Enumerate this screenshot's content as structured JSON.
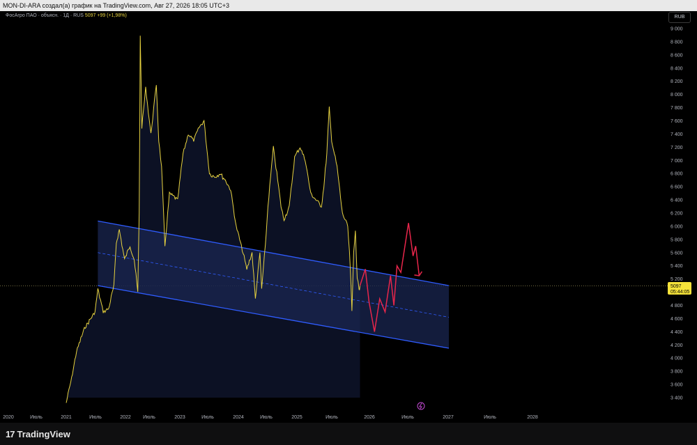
{
  "header": {
    "text": "MON-DI-ARA создал(а) график на TradingView.com, Авг 27, 2026 18:05 UTC+3"
  },
  "legend": {
    "symbol": "ФосАгро ПАО · объясн. · 1Д · RUS",
    "value": "5097 +99 (+1,98%)"
  },
  "currency": "RUB",
  "price_label": {
    "price": "5097",
    "countdown": "05:44:05"
  },
  "brand": {
    "logo": "17",
    "name": "TradingView"
  },
  "colors": {
    "price_line": "#e8d33f",
    "area_fill": "#1a2650",
    "channel": "#2f5cff",
    "forecast": "#e8264b",
    "label_bg": "#f5e23a"
  },
  "icons": [
    "lightning-icon",
    "tradingview-logo"
  ],
  "chart_data": {
    "type": "line",
    "x_ticks": [
      "2020",
      "Июль",
      "2021",
      "Июль",
      "2022",
      "Июль",
      "2023",
      "Июль",
      "2024",
      "Июль",
      "2025",
      "Июль",
      "2026",
      "Июль",
      "2027",
      "Июль",
      "2028"
    ],
    "y_ticks": [
      "9 000",
      "8 800",
      "8 600",
      "8 400",
      "8 200",
      "8 000",
      "7 800",
      "7 600",
      "7 400",
      "7 200",
      "7 000",
      "6 800",
      "6 600",
      "6 400",
      "6 200",
      "6 000",
      "5 800",
      "5 600",
      "5 400",
      "5 200",
      "4 800",
      "4 600",
      "4 400",
      "4 200",
      "4 000",
      "3 800",
      "3 600",
      "3 400"
    ],
    "y_range": [
      3300,
      9100
    ],
    "last_price": 5097,
    "series": [
      {
        "values": [
          [
            "2021-01-01",
            3320
          ],
          [
            "2021-02-01",
            3700
          ],
          [
            "2021-03-01",
            4100
          ],
          [
            "2021-04-15",
            4450
          ],
          [
            "2021-06-15",
            4700
          ],
          [
            "2021-07-01",
            5050
          ],
          [
            "2021-08-01",
            4700
          ],
          [
            "2021-09-01",
            4750
          ],
          [
            "2021-10-01",
            5100
          ],
          [
            "2021-10-15",
            5750
          ],
          [
            "2021-11-01",
            5950
          ],
          [
            "2021-12-01",
            5500
          ],
          [
            "2022-01-01",
            5700
          ],
          [
            "2022-01-25",
            5500
          ],
          [
            "2022-02-15",
            5000
          ],
          [
            "2022-02-23",
            6200
          ],
          [
            "2022-03-01",
            8900
          ],
          [
            "2022-03-10",
            7500
          ],
          [
            "2022-04-01",
            8100
          ],
          [
            "2022-05-01",
            7400
          ],
          [
            "2022-06-01",
            8150
          ],
          [
            "2022-06-15",
            7300
          ],
          [
            "2022-07-01",
            6900
          ],
          [
            "2022-07-20",
            5700
          ],
          [
            "2022-08-15",
            6500
          ],
          [
            "2022-10-01",
            6400
          ],
          [
            "2022-11-01",
            7100
          ],
          [
            "2022-12-01",
            7400
          ],
          [
            "2023-01-01",
            7300
          ],
          [
            "2023-02-01",
            7500
          ],
          [
            "2023-03-01",
            7600
          ],
          [
            "2023-04-01",
            6800
          ],
          [
            "2023-05-01",
            6750
          ],
          [
            "2023-06-01",
            6800
          ],
          [
            "2023-07-01",
            6700
          ],
          [
            "2023-08-01",
            6550
          ],
          [
            "2023-09-01",
            6000
          ],
          [
            "2023-10-01",
            5700
          ],
          [
            "2023-11-01",
            5350
          ],
          [
            "2023-12-01",
            5600
          ],
          [
            "2023-12-20",
            4900
          ],
          [
            "2024-01-15",
            5600
          ],
          [
            "2024-01-25",
            5050
          ],
          [
            "2024-02-15",
            5700
          ],
          [
            "2024-03-01",
            6300
          ],
          [
            "2024-04-01",
            7200
          ],
          [
            "2024-05-01",
            6600
          ],
          [
            "2024-05-15",
            6300
          ],
          [
            "2024-06-01",
            6100
          ],
          [
            "2024-07-01",
            6300
          ],
          [
            "2024-08-01",
            7050
          ],
          [
            "2024-09-01",
            7200
          ],
          [
            "2024-10-01",
            7000
          ],
          [
            "2024-11-01",
            6500
          ],
          [
            "2024-12-01",
            6400
          ],
          [
            "2025-01-01",
            6300
          ],
          [
            "2025-01-15",
            6600
          ],
          [
            "2025-02-01",
            7100
          ],
          [
            "2025-02-15",
            7800
          ],
          [
            "2025-03-01",
            7300
          ],
          [
            "2025-04-01",
            6900
          ],
          [
            "2025-05-01",
            6200
          ],
          [
            "2025-06-01",
            6000
          ],
          [
            "2025-06-15",
            5400
          ],
          [
            "2025-06-25",
            4700
          ],
          [
            "2025-07-05",
            5600
          ],
          [
            "2025-07-15",
            5950
          ],
          [
            "2025-07-25",
            5200
          ],
          [
            "2025-08-05",
            5050
          ],
          [
            "2025-08-10",
            5097
          ]
        ]
      },
      {
        "name": "forecast",
        "values": [
          [
            "2025-08-10",
            5100
          ],
          [
            "2025-09-10",
            5350
          ],
          [
            "2025-10-01",
            4850
          ],
          [
            "2025-11-01",
            4400
          ],
          [
            "2025-12-01",
            4900
          ],
          [
            "2026-01-01",
            4700
          ],
          [
            "2026-02-01",
            5250
          ],
          [
            "2026-02-20",
            4800
          ],
          [
            "2026-03-10",
            5400
          ],
          [
            "2026-04-01",
            5300
          ],
          [
            "2026-05-15",
            6050
          ],
          [
            "2026-06-10",
            5550
          ],
          [
            "2026-06-25",
            5700
          ],
          [
            "2026-07-15",
            5250
          ]
        ]
      }
    ],
    "channel": {
      "upper": [
        [
          "2021-07-01",
          6080
        ],
        [
          "2027-01-01",
          5100
        ]
      ],
      "middle": [
        [
          "2021-07-01",
          5600
        ],
        [
          "2027-01-01",
          4620
        ]
      ],
      "lower": [
        [
          "2021-07-01",
          5100
        ],
        [
          "2027-01-01",
          4150
        ]
      ]
    }
  }
}
